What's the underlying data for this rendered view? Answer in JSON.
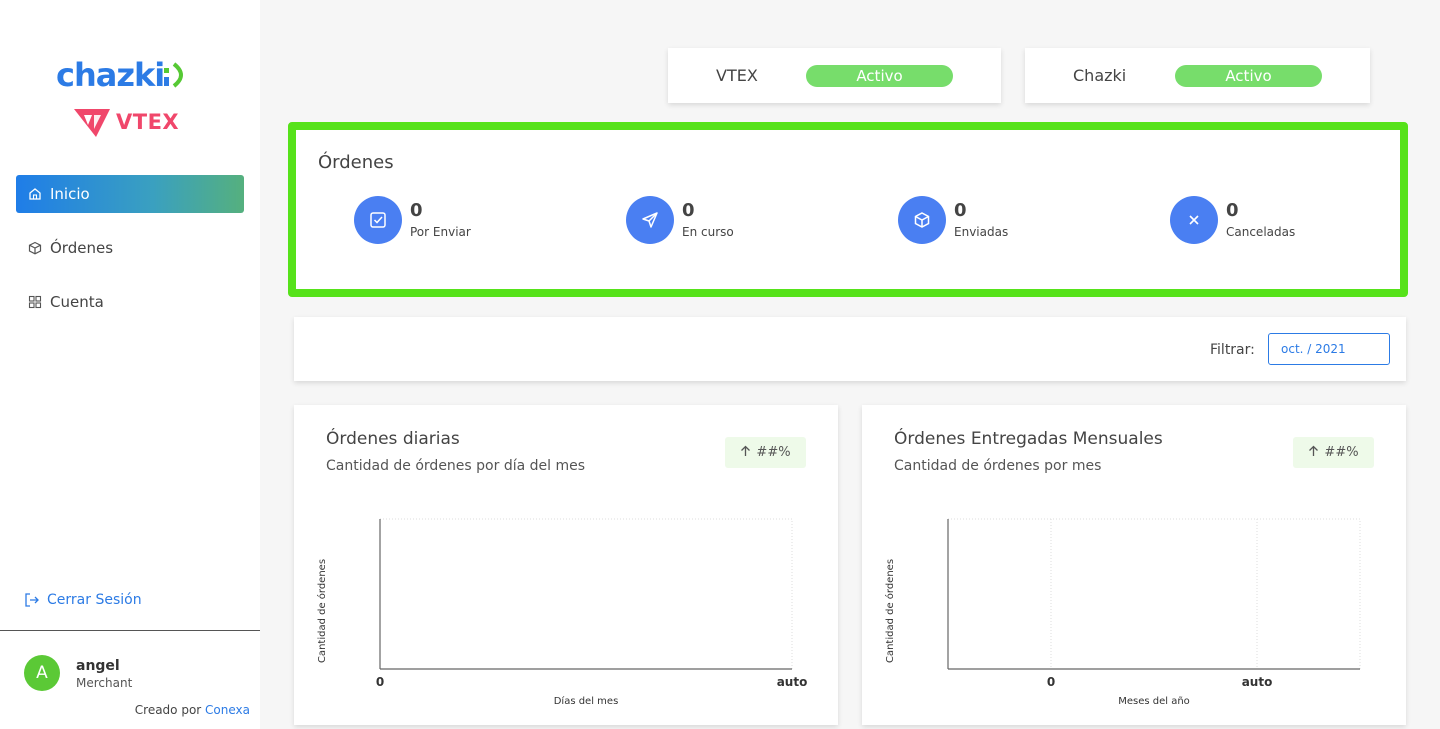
{
  "brand": {
    "chazki_logo": "chazki",
    "vtex_logo": "VTEX"
  },
  "sidebar": {
    "items": [
      {
        "label": "Inicio",
        "icon": "home-icon",
        "active": true
      },
      {
        "label": "Órdenes",
        "icon": "box-icon",
        "active": false
      },
      {
        "label": "Cuenta",
        "icon": "grid-icon",
        "active": false
      }
    ],
    "logout_label": "Cerrar Sesión",
    "user": {
      "initial": "A",
      "name": "angel",
      "role": "Merchant"
    },
    "credits_prefix": "Creado por",
    "credits_link": "Conexa"
  },
  "status": [
    {
      "name": "VTEX",
      "state": "Activo"
    },
    {
      "name": "Chazki",
      "state": "Activo"
    }
  ],
  "summary": {
    "title": "Órdenes",
    "stats": [
      {
        "value": "0",
        "label": "Por Enviar",
        "icon": "check-square-icon"
      },
      {
        "value": "0",
        "label": "En curso",
        "icon": "send-icon"
      },
      {
        "value": "0",
        "label": "Enviadas",
        "icon": "package-icon"
      },
      {
        "value": "0",
        "label": "Canceladas",
        "icon": "close-icon"
      }
    ]
  },
  "filter": {
    "label": "Filtrar:",
    "value": "oct. / 2021"
  },
  "charts": [
    {
      "title": "Órdenes diarias",
      "subtitle": "Cantidad de órdenes por día del mes",
      "badge": "##%",
      "ylabel": "Cantidad de órdenes",
      "xlabel": "Días del mes",
      "xticks": [
        "0",
        "auto"
      ]
    },
    {
      "title": "Órdenes Entregadas Mensuales",
      "subtitle": "Cantidad de órdenes por mes",
      "badge": "##%",
      "ylabel": "Cantidad de órdenes",
      "xlabel": "Meses del año",
      "xticks": [
        "0",
        "auto"
      ]
    }
  ],
  "chart_data": [
    {
      "type": "line",
      "title": "Órdenes diarias",
      "xlabel": "Días del mes",
      "ylabel": "Cantidad de órdenes",
      "x_ticks": [
        "0",
        "auto"
      ],
      "series": [],
      "grid": true
    },
    {
      "type": "line",
      "title": "Órdenes Entregadas Mensuales",
      "xlabel": "Meses del año",
      "ylabel": "Cantidad de órdenes",
      "x_ticks": [
        "0",
        "auto"
      ],
      "series": [],
      "grid": true
    }
  ],
  "colors": {
    "accent": "#2c7be5",
    "active_pill": "#77dd6b",
    "stat_icon_bg": "#4a7ff2",
    "summary_border": "#56e21a",
    "avatar": "#5bc936"
  }
}
